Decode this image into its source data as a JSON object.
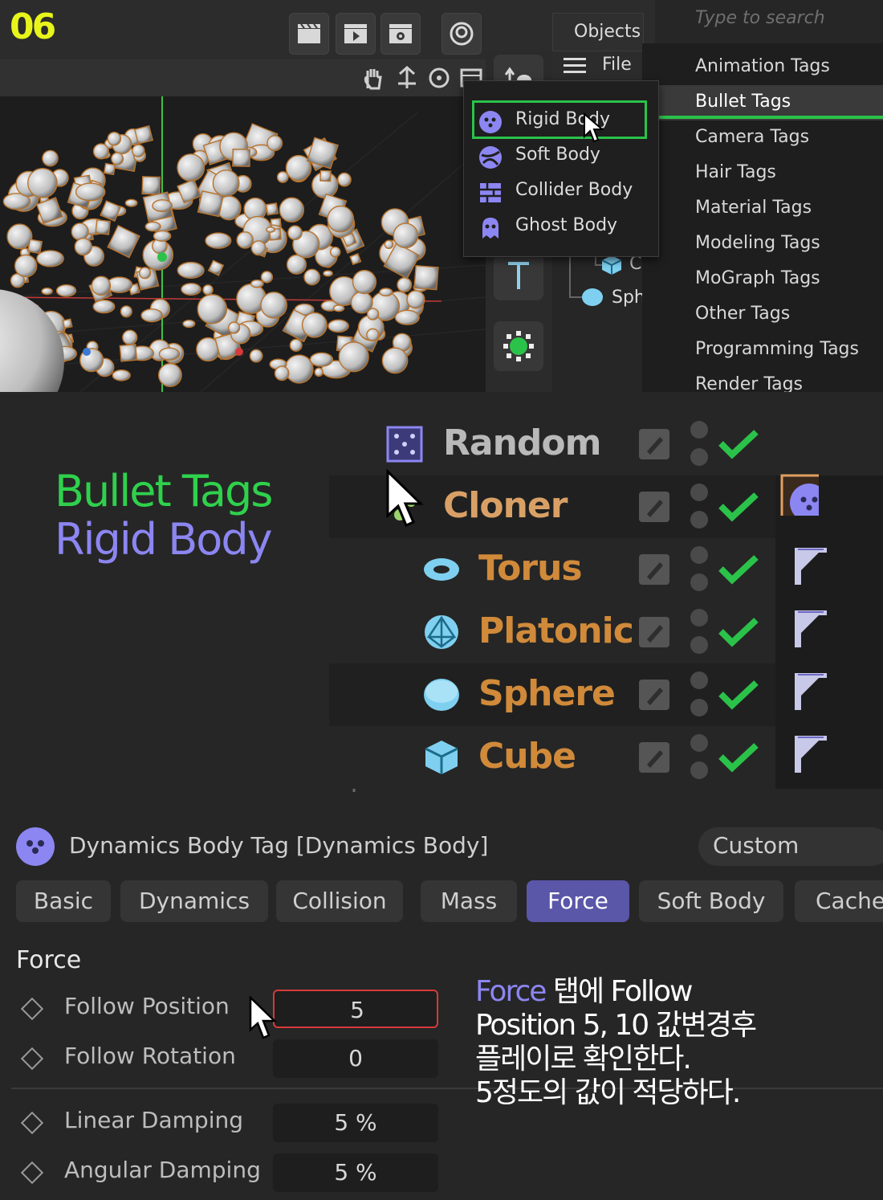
{
  "step_number": "06",
  "toolbar": {
    "icons": [
      "clapper-icon",
      "clapper-play-icon",
      "clapper-gear-icon",
      "spiral-icon"
    ],
    "tools": [
      "hand-icon",
      "move-icon",
      "rotate-icon",
      "frame-icon"
    ]
  },
  "object_manager": {
    "tab_label": "Objects",
    "file_menu": "File",
    "list_fragments": [
      "C",
      "Sph"
    ]
  },
  "tag_search": {
    "placeholder": "Type to search"
  },
  "tag_categories": [
    {
      "label": "Animation Tags",
      "active": false
    },
    {
      "label": "Bullet Tags",
      "active": true
    },
    {
      "label": "Camera Tags",
      "active": false
    },
    {
      "label": "Hair Tags",
      "active": false
    },
    {
      "label": "Material Tags",
      "active": false
    },
    {
      "label": "Modeling Tags",
      "active": false
    },
    {
      "label": "MoGraph Tags",
      "active": false
    },
    {
      "label": "Other Tags",
      "active": false
    },
    {
      "label": "Programming Tags",
      "active": false
    },
    {
      "label": "Render Tags",
      "active": false
    }
  ],
  "bullet_menu": [
    {
      "label": "Rigid Body",
      "icon": "rigid-body-icon",
      "selected": true
    },
    {
      "label": "Soft Body",
      "icon": "soft-body-icon",
      "selected": false
    },
    {
      "label": "Collider Body",
      "icon": "collider-body-icon",
      "selected": false
    },
    {
      "label": "Ghost Body",
      "icon": "ghost-body-icon",
      "selected": false
    }
  ],
  "caption": {
    "line1": "Bullet Tags",
    "line2": "Rigid Body"
  },
  "hierarchy": [
    {
      "name": "Random",
      "color": "#b9b9b9",
      "icon": "random-effector-icon",
      "tag": "none",
      "level": 0
    },
    {
      "name": "Cloner",
      "color": "#d9a066",
      "icon": "cloner-icon",
      "tag": "rigid-body-tag",
      "level": 0
    },
    {
      "name": "Torus",
      "color": "#d08a3a",
      "icon": "torus-icon",
      "tag": "phong-tag",
      "level": 1
    },
    {
      "name": "Platonic",
      "color": "#d08a3a",
      "icon": "platonic-icon",
      "tag": "phong-tag",
      "level": 1
    },
    {
      "name": "Sphere",
      "color": "#d08a3a",
      "icon": "sphere-icon",
      "tag": "phong-tag",
      "level": 1
    },
    {
      "name": "Cube",
      "color": "#d08a3a",
      "icon": "cube-icon",
      "tag": "phong-tag",
      "level": 1
    }
  ],
  "attributes": {
    "title": "Dynamics Body Tag [Dynamics Body]",
    "mode_button": "Custom",
    "tabs": [
      {
        "label": "Basic",
        "active": false
      },
      {
        "label": "Dynamics",
        "active": false
      },
      {
        "label": "Collision",
        "active": false
      },
      {
        "label": "Mass",
        "active": false
      },
      {
        "label": "Force",
        "active": true
      },
      {
        "label": "Soft Body",
        "active": false
      },
      {
        "label": "Cache",
        "active": false
      }
    ],
    "section": "Force",
    "fields": [
      {
        "label": "Follow Position",
        "value": "5",
        "highlighted": true
      },
      {
        "label": "Follow Rotation",
        "value": "0",
        "highlighted": false
      },
      {
        "label": "Linear Damping",
        "value": "5 %",
        "highlighted": false
      },
      {
        "label": "Angular Damping",
        "value": "5 %",
        "highlighted": false
      }
    ]
  },
  "note": {
    "highlight": "Force",
    "line1_rest": " 탭에 Follow",
    "line2": "Position 5, 10 값변경후",
    "line3": "플레이로 확인한다.",
    "line4": "5정도의 값이 적당하다."
  },
  "colors": {
    "step": "#e8f51a",
    "bullet_green": "#2fd14c",
    "rigid_purple": "#8c86f2",
    "highlight_green": "#2bc24a",
    "field_red": "#d63a3a"
  }
}
